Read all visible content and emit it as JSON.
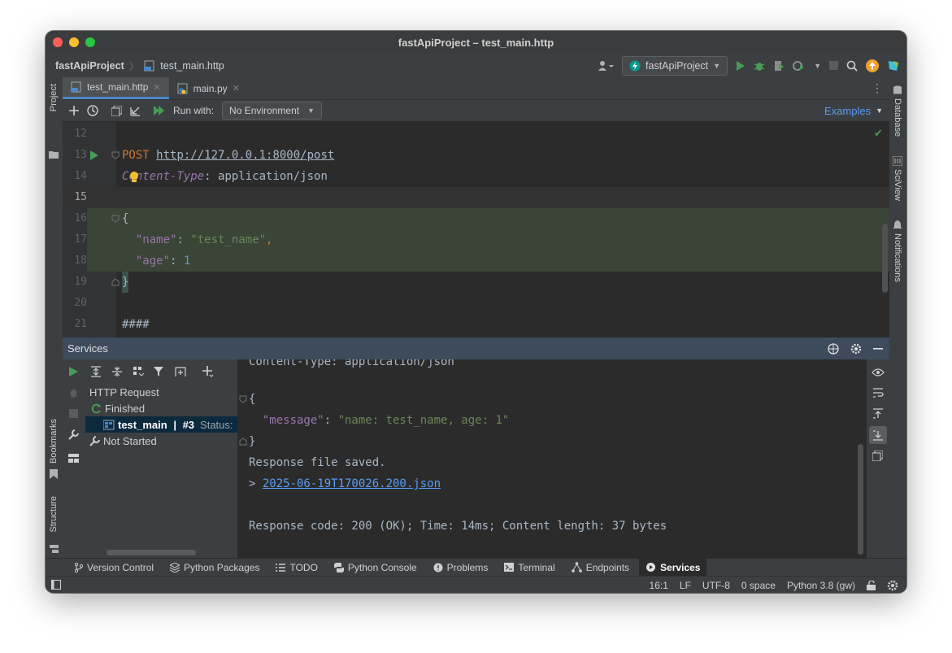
{
  "window": {
    "title": "fastApiProject – test_main.http"
  },
  "navbar": {
    "project": "fastApiProject",
    "file": "test_main.http",
    "run_config": "fastApiProject"
  },
  "tabs": [
    {
      "label": "test_main.http",
      "active": true
    },
    {
      "label": "main.py",
      "active": false
    }
  ],
  "request_bar": {
    "run_with_label": "Run with:",
    "environment": "No Environment",
    "examples_label": "Examples"
  },
  "editor": {
    "lines": [
      {
        "num": "12",
        "text": ""
      },
      {
        "num": "13",
        "method": "POST",
        "url": "http://127.0.0.1:8000/post"
      },
      {
        "num": "14",
        "header_name": "Content-Type",
        "header_value": "application/json"
      },
      {
        "num": "15",
        "text": ""
      },
      {
        "num": "16",
        "text": "{"
      },
      {
        "num": "17",
        "key": "\"name\"",
        "value": "\"test_name\""
      },
      {
        "num": "18",
        "key": "\"age\"",
        "value": "1"
      },
      {
        "num": "19",
        "text": "}"
      },
      {
        "num": "20",
        "text": ""
      },
      {
        "num": "21",
        "text": "####"
      }
    ]
  },
  "services": {
    "title": "Services",
    "tree": {
      "root": "HTTP Request",
      "finished": "Finished",
      "item_name": "test_main",
      "item_num": "#3",
      "item_status": "Status:",
      "not_started": "Not Started"
    },
    "response": {
      "header_line": "Content-Type: application/json",
      "open_brace": "{",
      "message_key": "\"message\"",
      "message_value": "\"name: test_name, age: 1\"",
      "close_brace": "}",
      "saved": "Response file saved.",
      "file_prefix": "> ",
      "file_link": "2025-06-19T170026.200.json",
      "summary": "Response code: 200 (OK); Time: 14ms; Content length: 37 bytes"
    }
  },
  "left_tools": {
    "project": "Project",
    "bookmarks": "Bookmarks",
    "structure": "Structure"
  },
  "right_tools": {
    "database": "Database",
    "sciview": "SciView",
    "notifications": "Notifications"
  },
  "bottom_tabs": [
    {
      "label": "Version Control",
      "icon": "branch-icon"
    },
    {
      "label": "Python Packages",
      "icon": "packages-icon"
    },
    {
      "label": "TODO",
      "icon": "list-icon"
    },
    {
      "label": "Python Console",
      "icon": "python-icon"
    },
    {
      "label": "Problems",
      "icon": "warning-icon"
    },
    {
      "label": "Terminal",
      "icon": "terminal-icon"
    },
    {
      "label": "Endpoints",
      "icon": "endpoints-icon"
    },
    {
      "label": "Services",
      "icon": "services-icon",
      "active": true
    }
  ],
  "status": {
    "position": "16:1",
    "line_sep": "LF",
    "encoding": "UTF-8",
    "indent": "0 space",
    "interpreter": "Python 3.8 (gw)"
  },
  "colors": {
    "keyword": "#cc7832",
    "url": "#a9b7c6",
    "header_name": "#9876aa",
    "string": "#6a8759",
    "json_key": "#9876aa",
    "number": "#6897bb",
    "link": "#589df6"
  }
}
